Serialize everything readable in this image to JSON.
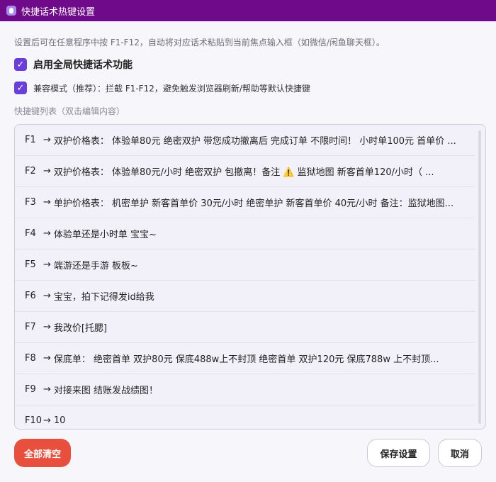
{
  "window": {
    "title": "快捷话术热键设置"
  },
  "description": "设置后可在任意程序中按 F1-F12，自动将对应话术粘贴到当前焦点输入框（如微信/闲鱼聊天框）。",
  "options": {
    "enable_global": {
      "label": "启用全局快捷话术功能",
      "checked": true
    },
    "compat_mode": {
      "label": "兼容模式（推荐）：拦截 F1-F12，避免触发浏览器刷新/帮助等默认快捷键",
      "checked": true
    }
  },
  "list": {
    "title": "快捷键列表（双击编辑内容）",
    "arrow": "→",
    "items": [
      {
        "key": "F1",
        "text": "双护价格表：  体验单80元 绝密双护 带您成功撤离后 完成订单 不限时间！  小时单100元 首单价 ..."
      },
      {
        "key": "F2",
        "text": "双护价格表：  体验单80元/小时 绝密双护 包撤离！备注 ⚠️  监狱地图 新客首单120/小时（ ..."
      },
      {
        "key": "F3",
        "text": "单护价格表：  机密单护 新客首单价 30元/小时 绝密单护 新客首单价 40元/小时 备注：监狱地图..."
      },
      {
        "key": "F4",
        "text": "体验单还是小时单 宝宝~"
      },
      {
        "key": "F5",
        "text": "端游还是手游 板板~"
      },
      {
        "key": "F6",
        "text": "宝宝，拍下记得发id给我"
      },
      {
        "key": "F7",
        "text": "我改价[托腮]"
      },
      {
        "key": "F8",
        "text": "保底单：  绝密首单 双护80元 保底488w上不封顶 绝密首单 双护120元 保底788w 上不封顶..."
      },
      {
        "key": "F9",
        "text": "对接来图 结账发战绩图！"
      },
      {
        "key": "F10",
        "text": "10"
      }
    ]
  },
  "buttons": {
    "clear_all": "全部清空",
    "save": "保存设置",
    "cancel": "取消"
  },
  "colors": {
    "titlebar": "#6f0a8a",
    "checkbox": "#6a3fd9",
    "danger": "#e84f3c"
  },
  "icons": {
    "app": "microphone-app-icon",
    "check": "checkmark-icon"
  }
}
